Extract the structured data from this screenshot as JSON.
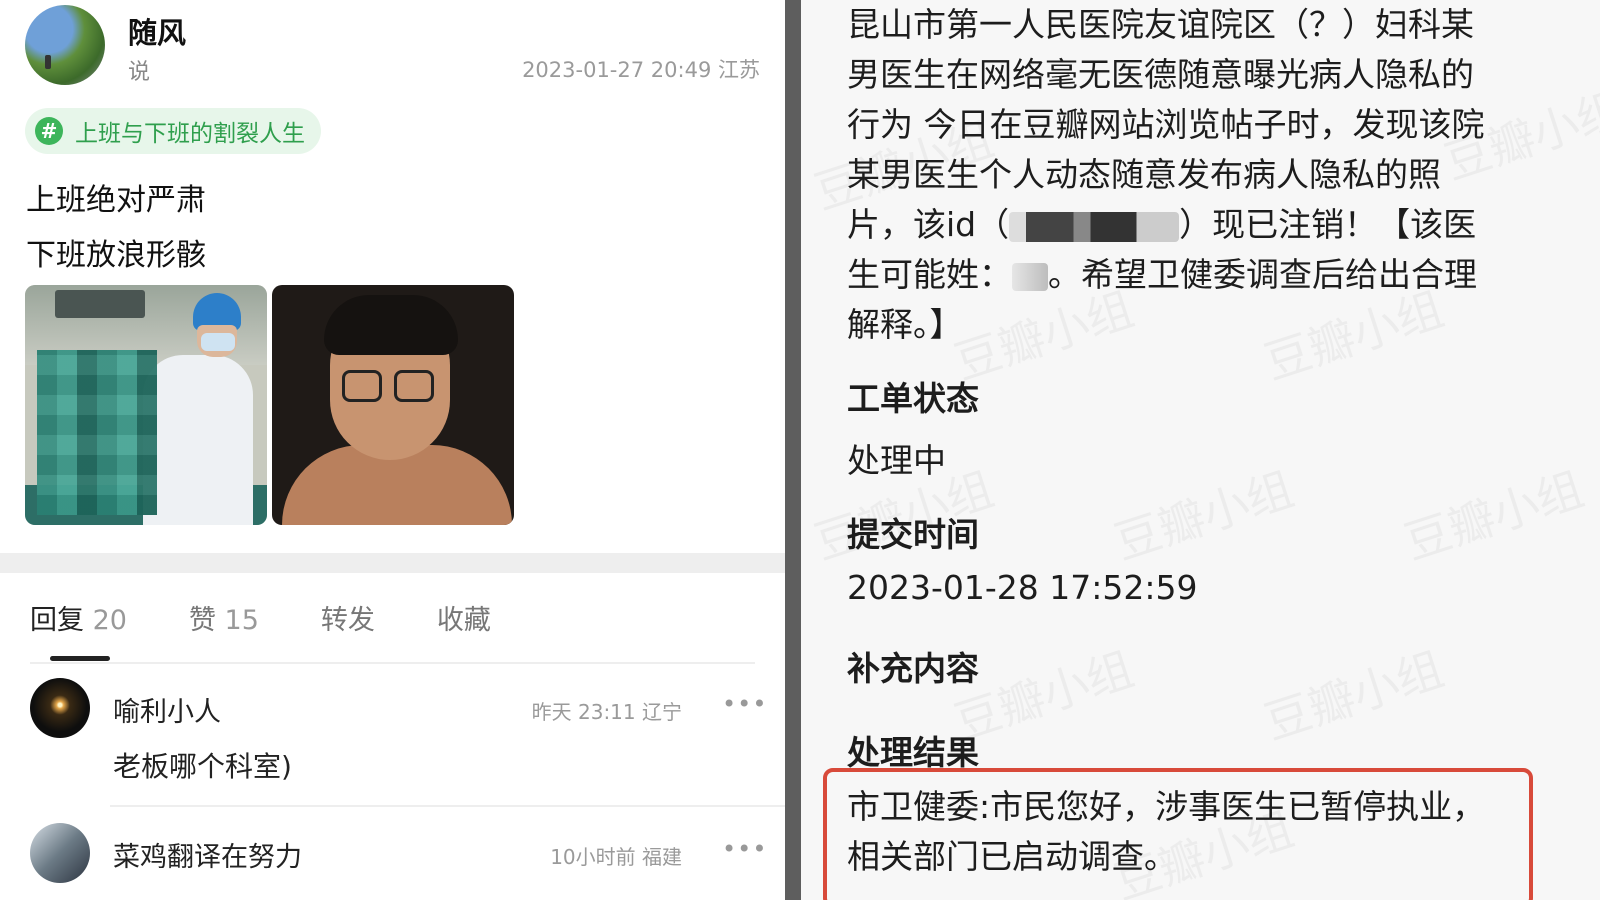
{
  "post": {
    "author": "随风",
    "subtext": "说",
    "timestamp": "2023-01-27 20:49",
    "location": "江苏",
    "topic": "上班与下班的割裂人生",
    "lines": [
      "上班绝对严肃",
      "下班放浪形骸"
    ]
  },
  "tabs": [
    {
      "label": "回复",
      "count": "20",
      "active": true
    },
    {
      "label": "赞",
      "count": "15",
      "active": false
    },
    {
      "label": "转发",
      "count": "",
      "active": false
    },
    {
      "label": "收藏",
      "count": "",
      "active": false
    }
  ],
  "comments": [
    {
      "name": "喻利小人",
      "time": "昨天 23:11",
      "location": "辽宁",
      "text": "老板哪个科室)"
    },
    {
      "name": "菜鸡翻译在努力",
      "time": "10小时前",
      "location": "福建",
      "text": ""
    }
  ],
  "complaint": {
    "line1": "昆山市第一人民医院友谊院区（？）妇科某",
    "line2": "男医生在网络毫无医德随意曝光病人隐私的",
    "line3": "行为 今日在豆瓣网站浏览帖子时，发现该院",
    "line4": "某男医生个人动态随意发布病人隐私的照",
    "line5a": "片，该id（",
    "line5b": "）现已注销！【该医",
    "line6a": "生可能姓：",
    "line6b": "。希望卫健委调查后给出合理",
    "line7": "解释。】"
  },
  "fields": {
    "status_label": "工单状态",
    "status_value": "处理中",
    "time_label": "提交时间",
    "time_value": "2023-01-28 17:52:59",
    "extra_label": "补充内容",
    "result_label": "处理结果",
    "result_line1": "市卫健委:市民您好，涉事医生已暂停执业，",
    "result_line2": "相关部门已启动调查。"
  },
  "watermark": "豆瓣小组",
  "colors": {
    "accent_green": "#3db55b",
    "highlight_red": "#d84a3a"
  }
}
